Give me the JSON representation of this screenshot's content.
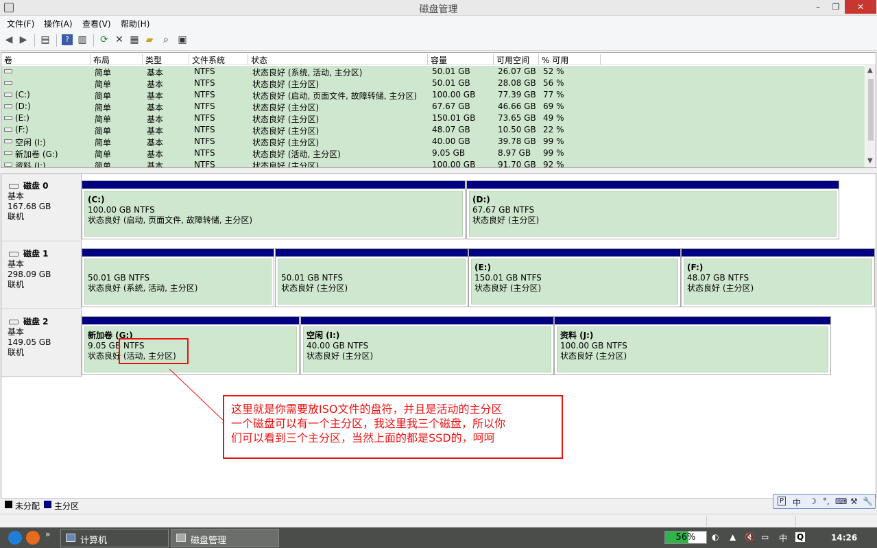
{
  "window": {
    "title": "磁盘管理",
    "min": "–",
    "max": "❐",
    "close": "✕"
  },
  "menu": [
    "文件(F)",
    "操作(A)",
    "查看(V)",
    "帮助(H)"
  ],
  "toolbar_icons": [
    "back-icon",
    "forward-icon",
    "console-tree-icon",
    "help-icon",
    "properties-pane-icon",
    "refresh-icon",
    "delete-icon",
    "properties-icon",
    "open-icon",
    "search-icon",
    "export-icon"
  ],
  "columns": [
    "卷",
    "布局",
    "类型",
    "文件系统",
    "状态",
    "容量",
    "可用空间",
    "% 可用"
  ],
  "volumes": [
    {
      "vol": "",
      "layout": "简单",
      "type": "基本",
      "fs": "NTFS",
      "status": "状态良好 (系统, 活动, 主分区)",
      "capacity": "50.01 GB",
      "free": "26.07 GB",
      "pct": "52 %"
    },
    {
      "vol": "",
      "layout": "简单",
      "type": "基本",
      "fs": "NTFS",
      "status": "状态良好 (主分区)",
      "capacity": "50.01 GB",
      "free": "28.08 GB",
      "pct": "56 %"
    },
    {
      "vol": "(C:)",
      "layout": "简单",
      "type": "基本",
      "fs": "NTFS",
      "status": "状态良好 (启动, 页面文件, 故障转储, 主分区)",
      "capacity": "100.00 GB",
      "free": "77.39 GB",
      "pct": "77 %"
    },
    {
      "vol": "(D:)",
      "layout": "简单",
      "type": "基本",
      "fs": "NTFS",
      "status": "状态良好 (主分区)",
      "capacity": "67.67 GB",
      "free": "46.66 GB",
      "pct": "69 %"
    },
    {
      "vol": "(E:)",
      "layout": "简单",
      "type": "基本",
      "fs": "NTFS",
      "status": "状态良好 (主分区)",
      "capacity": "150.01 GB",
      "free": "73.65 GB",
      "pct": "49 %"
    },
    {
      "vol": "(F:)",
      "layout": "简单",
      "type": "基本",
      "fs": "NTFS",
      "status": "状态良好 (主分区)",
      "capacity": "48.07 GB",
      "free": "10.50 GB",
      "pct": "22 %"
    },
    {
      "vol": "空闲 (I:)",
      "layout": "简单",
      "type": "基本",
      "fs": "NTFS",
      "status": "状态良好 (主分区)",
      "capacity": "40.00 GB",
      "free": "39.78 GB",
      "pct": "99 %"
    },
    {
      "vol": "新加卷 (G:)",
      "layout": "简单",
      "type": "基本",
      "fs": "NTFS",
      "status": "状态良好 (活动, 主分区)",
      "capacity": "9.05 GB",
      "free": "8.97 GB",
      "pct": "99 %"
    },
    {
      "vol": "资料 (J:)",
      "layout": "简单",
      "type": "基本",
      "fs": "NTFS",
      "status": "状态良好 (主分区)",
      "capacity": "100.00 GB",
      "free": "91.70 GB",
      "pct": "92 %"
    }
  ],
  "disks": [
    {
      "name": "磁盘 0",
      "type": "基本",
      "size": "167.68 GB",
      "state": "联机",
      "parts": [
        {
          "name": "(C:)",
          "size": "100.00 GB NTFS",
          "status": "状态良好 (启动, 页面文件, 故障转储, 主分区)"
        },
        {
          "name": "(D:)",
          "size": "67.67 GB NTFS",
          "status": "状态良好 (主分区)"
        }
      ]
    },
    {
      "name": "磁盘 1",
      "type": "基本",
      "size": "298.09 GB",
      "state": "联机",
      "parts": [
        {
          "name": "",
          "size": "50.01 GB NTFS",
          "status": "状态良好 (系统, 活动, 主分区)"
        },
        {
          "name": "",
          "size": "50.01 GB NTFS",
          "status": "状态良好 (主分区)"
        },
        {
          "name": "(E:)",
          "size": "150.01 GB NTFS",
          "status": "状态良好 (主分区)"
        },
        {
          "name": "(F:)",
          "size": "48.07 GB NTFS",
          "status": "状态良好 (主分区)"
        }
      ]
    },
    {
      "name": "磁盘 2",
      "type": "基本",
      "size": "149.05 GB",
      "state": "联机",
      "parts": [
        {
          "name": "新加卷  (G:)",
          "size": "9.05 GB NTFS",
          "status": "状态良好 (活动, 主分区)"
        },
        {
          "name": "空闲  (I:)",
          "size": "40.00 GB NTFS",
          "status": "状态良好 (主分区)"
        },
        {
          "name": "资料  (J:)",
          "size": "100.00 GB NTFS",
          "status": "状态良好 (主分区)"
        }
      ]
    }
  ],
  "annotation": {
    "lines": [
      "这里就是你需要放ISO文件的盘符，并且是活动的主分区",
      "一个磁盘可以有一个主分区，我这里我三个磁盘，所以你",
      "们可以看到三个主分区，当然上面的都是SSD的，呵呵"
    ],
    "color": "#ee1111"
  },
  "legend": [
    {
      "label": "未分配",
      "color": "#000000"
    },
    {
      "label": "主分区",
      "color": "#000080"
    }
  ],
  "langbar": [
    "中",
    "☽",
    "°,",
    "⌨",
    "⚒",
    "🔧"
  ],
  "taskbar": {
    "tasks": [
      "计算机",
      "磁盘管理"
    ],
    "battery": "56%",
    "battery_level": 0.56,
    "ime": "中",
    "clock": "14:26"
  },
  "colors": {
    "primary_partition": "#000080",
    "healthy": "#cfe7cf"
  }
}
